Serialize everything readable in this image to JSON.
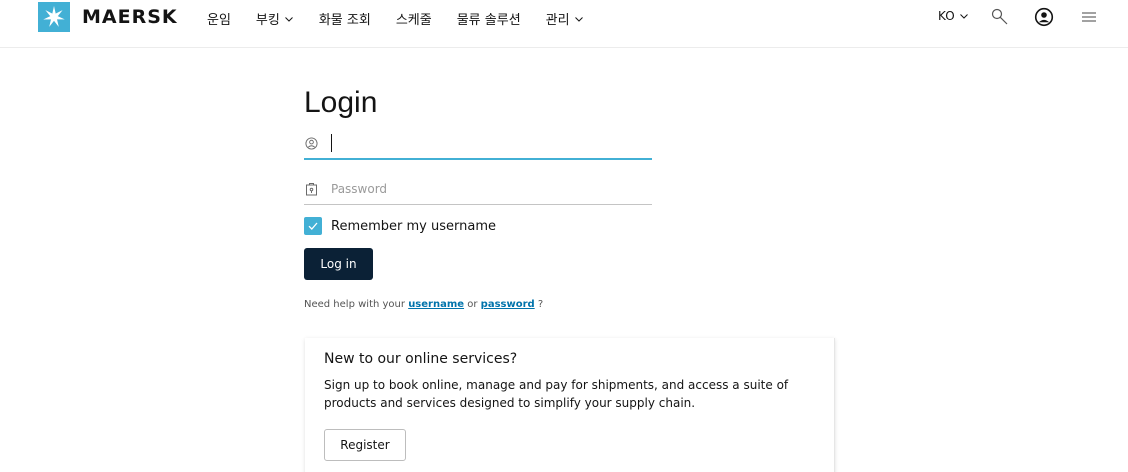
{
  "header": {
    "brand": "MAERSK",
    "nav": [
      {
        "label": "운임",
        "has_dropdown": false
      },
      {
        "label": "부킹",
        "has_dropdown": true
      },
      {
        "label": "화물 조회",
        "has_dropdown": false
      },
      {
        "label": "스케줄",
        "has_dropdown": false
      },
      {
        "label": "물류 솔루션",
        "has_dropdown": false
      },
      {
        "label": "관리",
        "has_dropdown": true
      }
    ],
    "language": "KO",
    "icons": [
      "search-icon",
      "user-account-icon",
      "hamburger-menu-icon"
    ]
  },
  "login": {
    "title": "Login",
    "username": {
      "value": "",
      "placeholder": "",
      "icon": "user-icon"
    },
    "password": {
      "value": "",
      "placeholder": "Password",
      "icon": "lock-icon"
    },
    "remember_label": "Remember my username",
    "remember_checked": true,
    "submit_label": "Log in",
    "help": {
      "prefix": "Need help with your",
      "username_link": "username",
      "middle": "or",
      "password_link": "password",
      "suffix": "?"
    }
  },
  "register_card": {
    "title": "New to our online services?",
    "description": "Sign up to book online, manage and pay for shipments, and access a suite of products and services designed to simplify your supply chain.",
    "button_label": "Register"
  },
  "colors": {
    "brand": "#42b0d5",
    "primary_button": "#0b2136",
    "link": "#0073ab"
  }
}
